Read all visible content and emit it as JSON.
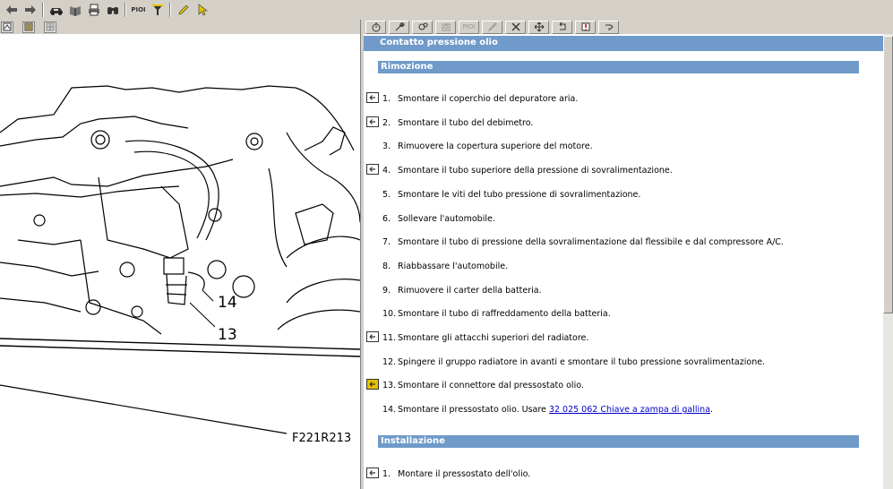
{
  "toolbar": {
    "icons": [
      "back-icon",
      "forward-icon",
      "car-icon",
      "book-icon",
      "print-icon",
      "binoculars-icon",
      "pioi-icon",
      "funnel-icon",
      "pencil-icon",
      "cursor-icon"
    ],
    "pioi_label": "PIOI"
  },
  "image": {
    "callout_14": "14",
    "callout_13": "13",
    "figure_id": "F221R213"
  },
  "right_toolbar": {
    "pioi_label": "PIOI"
  },
  "doc": {
    "title": "Contatto pressione olio",
    "removal_header": "Rimozione",
    "installation_header": "Installazione",
    "removal_steps": [
      {
        "num": "1.",
        "text": "Smontare il coperchio del depuratore aria.",
        "icon": "ref-icon"
      },
      {
        "num": "2.",
        "text": "Smontare il tubo del debimetro.",
        "icon": "ref-icon"
      },
      {
        "num": "3.",
        "text": "Rimuovere la copertura superiore del motore.",
        "icon": ""
      },
      {
        "num": "4.",
        "text": "Smontare il tubo superiore della pressione di sovralimentazione.",
        "icon": "ref-icon"
      },
      {
        "num": "5.",
        "text": "Smontare le viti del tubo pressione di sovralimentazione.",
        "icon": ""
      },
      {
        "num": "6.",
        "text": "Sollevare l'automobile.",
        "icon": ""
      },
      {
        "num": "7.",
        "text": "Smontare il tubo di pressione della sovralimentazione dal flessibile e dal compressore A/C.",
        "icon": ""
      },
      {
        "num": "8.",
        "text": "Riabbassare l'automobile.",
        "icon": ""
      },
      {
        "num": "9.",
        "text": "Rimuovere il carter della batteria.",
        "icon": ""
      },
      {
        "num": "10.",
        "text": "Smontare il tubo di raffreddamento della batteria.",
        "icon": ""
      },
      {
        "num": "11.",
        "text": "Smontare gli attacchi superiori del radiatore.",
        "icon": "ref-icon"
      },
      {
        "num": "12.",
        "text": "Spingere il gruppo radiatore in avanti e smontare il tubo pressione sovralimentazione.",
        "icon": ""
      },
      {
        "num": "13.",
        "text": "Smontare il connettore dal pressostato olio.",
        "icon": "ref-icon-active"
      },
      {
        "num": "14.",
        "text": "Smontare il pressostato olio. Usare ",
        "icon": "",
        "link": "32 025 062 Chiave a zampa di gallina",
        "after": "."
      }
    ],
    "installation_steps": [
      {
        "num": "1.",
        "text": "Montare il pressostato dell'olio.",
        "icon": "ref-icon"
      }
    ]
  },
  "colors": {
    "header_bg": "#6f9ac9",
    "window_bg": "#d4d0c8",
    "link": "#0000cc"
  }
}
